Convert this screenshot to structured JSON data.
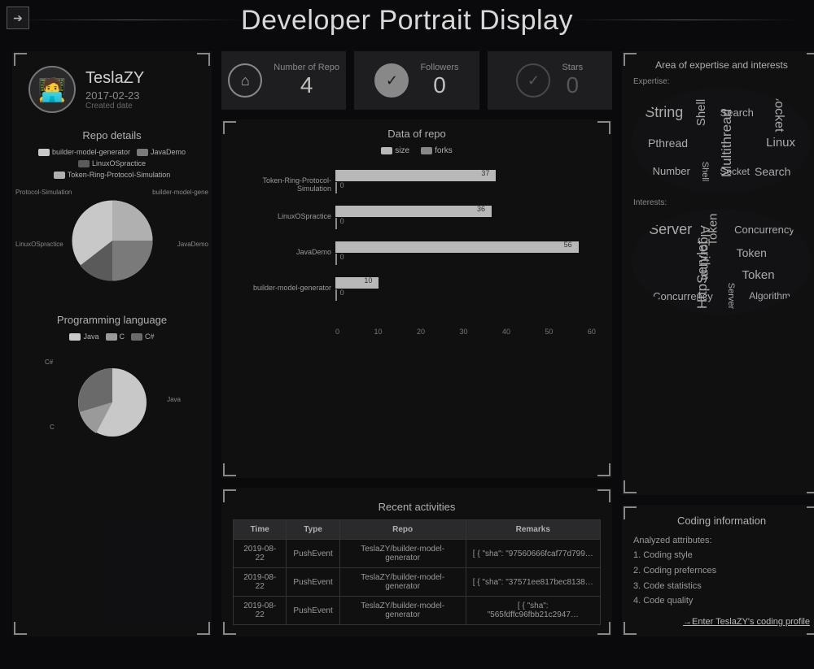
{
  "page": {
    "title": "Developer Portrait Display"
  },
  "profile": {
    "name": "TeslaZY",
    "date": "2017-02-23",
    "date_label": "Created date"
  },
  "repo_details": {
    "title": "Repo details",
    "items": [
      "builder-model-generator",
      "JavaDemo",
      "LinuxOSpractice",
      "Token-Ring-Protocol-Simulation"
    ],
    "pie_labels": {
      "top_left": "Protocol-Simulation",
      "top_right": "builder-model-gene",
      "mid_left": "LinuxOSpractice",
      "mid_right": "JavaDemo"
    }
  },
  "lang": {
    "title": "Programming language",
    "items": [
      "Java",
      "C",
      "C#"
    ],
    "pie_labels": {
      "top": "C#",
      "right": "Java",
      "left": "C"
    }
  },
  "stats": {
    "repo_label": "Number of Repo",
    "repo_val": "4",
    "followers_label": "Followers",
    "followers_val": "0",
    "stars_label": "Stars",
    "stars_val": "0"
  },
  "chart_data": {
    "type": "bar",
    "orientation": "horizontal",
    "title": "Data of repo",
    "legend": [
      "size",
      "forks"
    ],
    "categories": [
      "Token-Ring-Protocol-Simulation",
      "LinuxOSpractice",
      "JavaDemo",
      "builder-model-generator"
    ],
    "series": [
      {
        "name": "size",
        "values": [
          37,
          36,
          56,
          10
        ]
      },
      {
        "name": "forks",
        "values": [
          0,
          0,
          0,
          0
        ]
      }
    ],
    "xlim": [
      0,
      60
    ],
    "xticks": [
      0,
      10,
      20,
      30,
      40,
      50,
      60
    ]
  },
  "activities": {
    "title": "Recent activities",
    "columns": [
      "Time",
      "Type",
      "Repo",
      "Remarks"
    ],
    "rows": [
      {
        "time": "2019-08-22",
        "type": "PushEvent",
        "repo": "TeslaZY/builder-model-generator",
        "remarks": "[ { \"sha\": \"97560666fcaf77d799…"
      },
      {
        "time": "2019-08-22",
        "type": "PushEvent",
        "repo": "TeslaZY/builder-model-generator",
        "remarks": "[ { \"sha\": \"37571ee817bec8138…"
      },
      {
        "time": "2019-08-22",
        "type": "PushEvent",
        "repo": "TeslaZY/builder-model-generator",
        "remarks": "[ { \"sha\": \"565fdffc96fbb21c2947…"
      }
    ]
  },
  "expertise": {
    "title": "Area of expertise and interests",
    "expertise_label": "Expertise:",
    "interests_label": "Interests:",
    "expertise_words": [
      "String",
      "Shell",
      "Search",
      "Socket",
      "Pthread",
      "Multithread",
      "Linux",
      "Number",
      "Shell",
      "Socket",
      "Search"
    ],
    "interests_words": [
      "Server",
      "Token",
      "Concurrency",
      "Algorithm",
      "Token",
      "HttpServlet",
      "Token",
      "Concurrency",
      "Server",
      "Algorithm"
    ]
  },
  "coding_info": {
    "title": "Coding information",
    "subtitle": "Analyzed attributes:",
    "items": [
      "1. Coding style",
      "2. Coding prefernces",
      "3. Code statistics",
      "4. Code quality"
    ],
    "link": "→Enter TeslaZY's coding profile"
  }
}
